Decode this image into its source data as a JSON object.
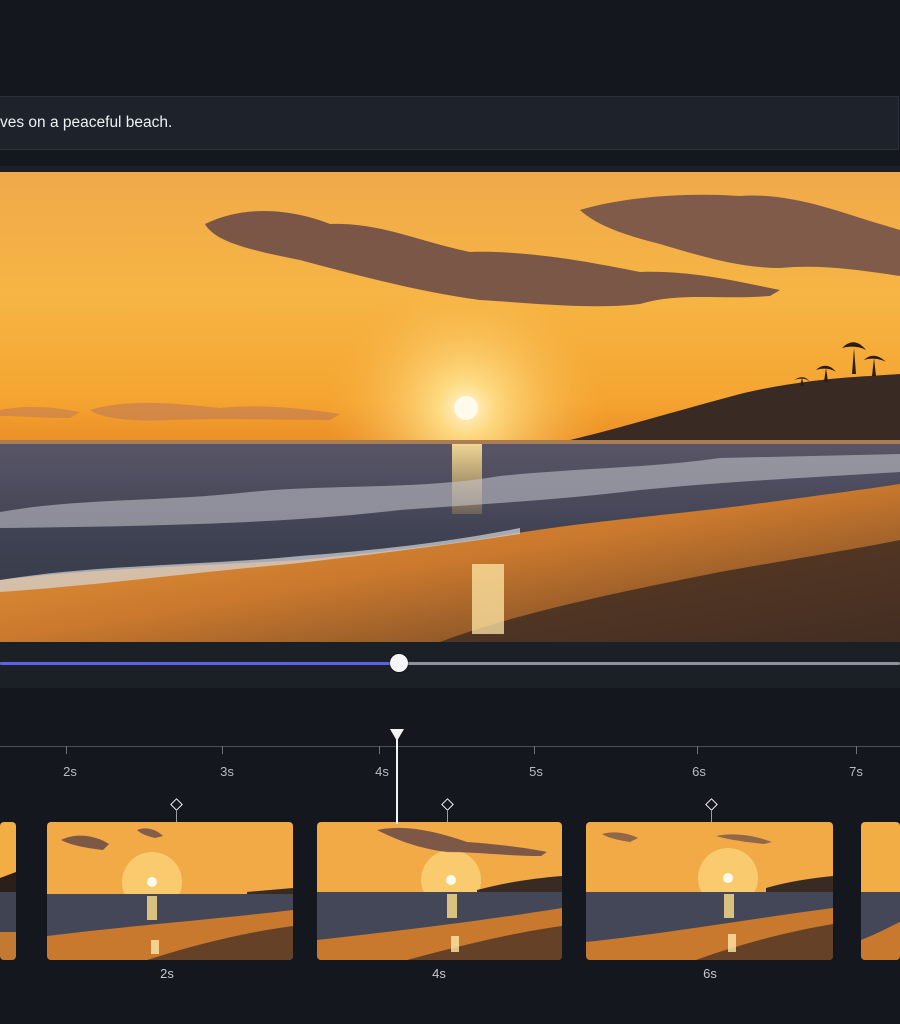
{
  "prompt": {
    "text": "ves on a peaceful beach."
  },
  "preview": {
    "image": "sunset-beach-scene",
    "scrub_progress": 0.443
  },
  "timeline": {
    "ticks": [
      "2s",
      "3s",
      "4s",
      "5s",
      "6s",
      "7s"
    ],
    "playhead_time": "4.1s",
    "keyframes": [
      {
        "label": "2s",
        "icon": "keyframe-diamond-icon"
      },
      {
        "label": "4s",
        "icon": "keyframe-diamond-icon"
      },
      {
        "label": "6s",
        "icon": "keyframe-diamond-icon"
      }
    ]
  },
  "colors": {
    "accent": "#5a63e6",
    "background": "#14171d",
    "panel": "#1e222a"
  }
}
